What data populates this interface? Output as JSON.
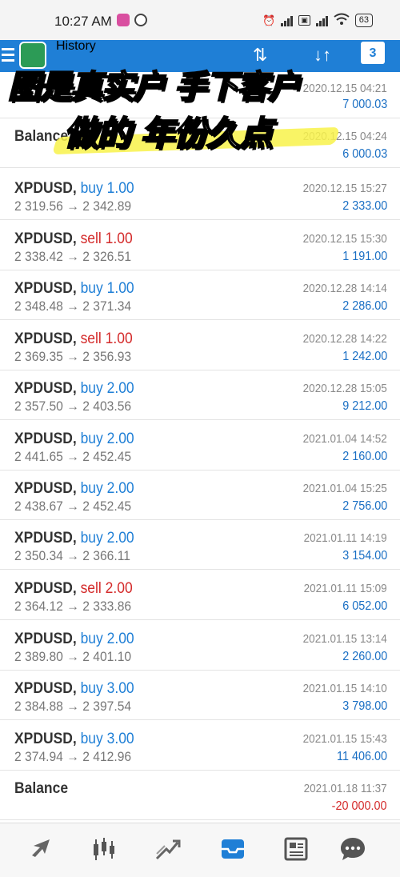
{
  "status_bar": {
    "time": "10:27 AM",
    "battery": "63"
  },
  "header": {
    "title": "History",
    "partial_date": "2020.12.15 04:21",
    "partial_amount": "7 000.03"
  },
  "overlay": {
    "line1": "图是真实户 手下客户",
    "line2": "做的 年份久点"
  },
  "rows": [
    {
      "title": "Balance",
      "type": "",
      "type_class": "",
      "prices": "",
      "date": "2020.12.15 04:24",
      "profit": "6 000.03",
      "neg": false
    },
    {
      "title": "XPDUSD,",
      "type": "buy 1.00",
      "type_class": "buy",
      "prices": "2 319.56 → 2 342.89",
      "date": "2020.12.15 15:27",
      "profit": "2 333.00",
      "neg": false
    },
    {
      "title": "XPDUSD,",
      "type": "sell 1.00",
      "type_class": "sell",
      "prices": "2 338.42 → 2 326.51",
      "date": "2020.12.15 15:30",
      "profit": "1 191.00",
      "neg": false
    },
    {
      "title": "XPDUSD,",
      "type": "buy 1.00",
      "type_class": "buy",
      "prices": "2 348.48 → 2 371.34",
      "date": "2020.12.28 14:14",
      "profit": "2 286.00",
      "neg": false
    },
    {
      "title": "XPDUSD,",
      "type": "sell 1.00",
      "type_class": "sell",
      "prices": "2 369.35 → 2 356.93",
      "date": "2020.12.28 14:22",
      "profit": "1 242.00",
      "neg": false
    },
    {
      "title": "XPDUSD,",
      "type": "buy 2.00",
      "type_class": "buy",
      "prices": "2 357.50 → 2 403.56",
      "date": "2020.12.28 15:05",
      "profit": "9 212.00",
      "neg": false
    },
    {
      "title": "XPDUSD,",
      "type": "buy 2.00",
      "type_class": "buy",
      "prices": "2 441.65 → 2 452.45",
      "date": "2021.01.04 14:52",
      "profit": "2 160.00",
      "neg": false
    },
    {
      "title": "XPDUSD,",
      "type": "buy 2.00",
      "type_class": "buy",
      "prices": "2 438.67 → 2 452.45",
      "date": "2021.01.04 15:25",
      "profit": "2 756.00",
      "neg": false
    },
    {
      "title": "XPDUSD,",
      "type": "buy 2.00",
      "type_class": "buy",
      "prices": "2 350.34 → 2 366.11",
      "date": "2021.01.11 14:19",
      "profit": "3 154.00",
      "neg": false
    },
    {
      "title": "XPDUSD,",
      "type": "sell 2.00",
      "type_class": "sell",
      "prices": "2 364.12 → 2 333.86",
      "date": "2021.01.11 15:09",
      "profit": "6 052.00",
      "neg": false
    },
    {
      "title": "XPDUSD,",
      "type": "buy 2.00",
      "type_class": "buy",
      "prices": "2 389.80 → 2 401.10",
      "date": "2021.01.15 13:14",
      "profit": "2 260.00",
      "neg": false
    },
    {
      "title": "XPDUSD,",
      "type": "buy 3.00",
      "type_class": "buy",
      "prices": "2 384.88 → 2 397.54",
      "date": "2021.01.15 14:10",
      "profit": "3 798.00",
      "neg": false
    },
    {
      "title": "XPDUSD,",
      "type": "buy 3.00",
      "type_class": "buy",
      "prices": "2 374.94 → 2 412.96",
      "date": "2021.01.15 15:43",
      "profit": "11 406.00",
      "neg": false
    },
    {
      "title": "Balance",
      "type": "",
      "type_class": "",
      "prices": "",
      "date": "2021.01.18 11:37",
      "profit": "-20 000.00",
      "neg": true
    }
  ],
  "bottom_nav": [
    {
      "name": "quotes-icon",
      "active": false
    },
    {
      "name": "chart-candles-icon",
      "active": false
    },
    {
      "name": "trade-icon",
      "active": false
    },
    {
      "name": "history-inbox-icon",
      "active": true
    },
    {
      "name": "news-icon",
      "active": false
    },
    {
      "name": "chat-icon",
      "active": false
    }
  ],
  "colors": {
    "accent": "#1f7fd6",
    "sell": "#d42a2a",
    "highlight": "#f8f24a"
  }
}
